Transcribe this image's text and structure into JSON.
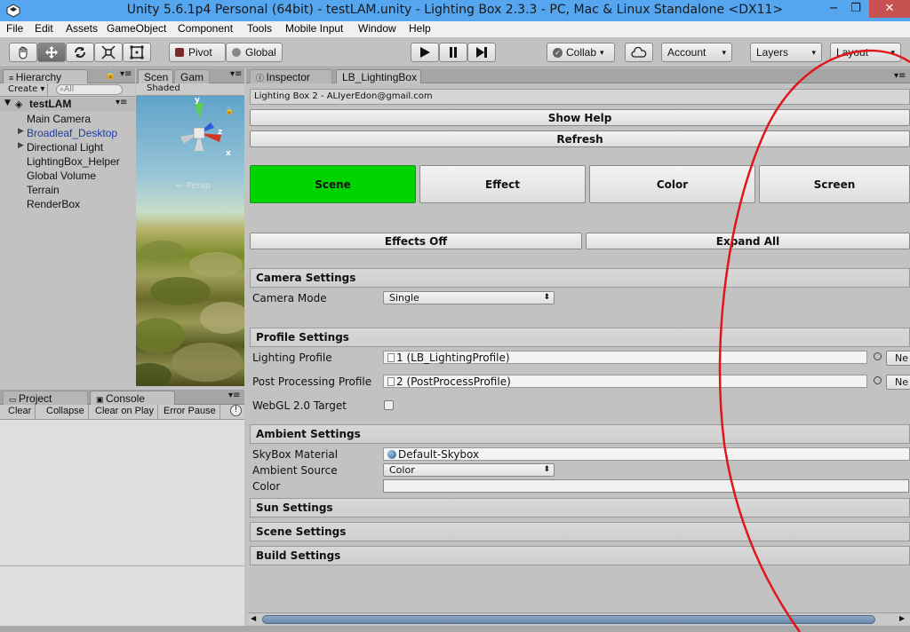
{
  "window": {
    "title": "Unity 5.6.1p4 Personal (64bit) - testLAM.unity - Lighting Box 2.3.3 - PC, Mac & Linux Standalone <DX11>",
    "minimize": "−",
    "maximize": "❐",
    "close": "✕"
  },
  "menu": [
    "File",
    "Edit",
    "Assets",
    "GameObject",
    "Component",
    "Tools",
    "Mobile Input",
    "Window",
    "Help"
  ],
  "toolbar": {
    "pivot": "Pivot",
    "global": "Global",
    "collab": "Collab",
    "account": "Account",
    "layers": "Layers",
    "layout": "Layout",
    "dropdown_glyph": "▾"
  },
  "hierarchy": {
    "tab": "Hierarchy",
    "create": "Create",
    "search_placeholder": "All",
    "scene": "testLAM",
    "items": [
      "Main Camera",
      "Broadleaf_Desktop",
      "Directional Light",
      "LightingBox_Helper",
      "Global Volume",
      "Terrain",
      "RenderBox"
    ]
  },
  "scene_view": {
    "tab_scene": "Scen",
    "tab_game": "Gam",
    "shading": "Shaded",
    "gizmo_persp": "← Persp",
    "axis_y": "y",
    "axis_z": "z",
    "axis_x": "x"
  },
  "console": {
    "tab_project": "Project",
    "tab_console": "Console",
    "buttons": [
      "Clear",
      "Collapse",
      "Clear on Play",
      "Error Pause"
    ]
  },
  "inspector": {
    "tab_inspector": "Inspector",
    "tab_lighting": "LB_LightingBox",
    "header": "Lighting Box 2 - ALIyerEdon@gmail.com",
    "show_help": "Show Help",
    "refresh": "Refresh",
    "categories": [
      "Scene",
      "Effect",
      "Color",
      "Screen"
    ],
    "effects_off": "Effects Off",
    "expand_all": "Expand All",
    "camera_settings": "Camera Settings",
    "camera_mode_label": "Camera Mode",
    "camera_mode_value": "Single",
    "profile_settings": "Profile Settings",
    "lighting_profile_label": "Lighting Profile",
    "lighting_profile_value": "1 (LB_LightingProfile)",
    "post_profile_label": "Post Processing Profile",
    "post_profile_value": "2 (PostProcessProfile)",
    "new_button": "Ne",
    "webgl_label": "WebGL 2.0 Target",
    "ambient_settings": "Ambient Settings",
    "skybox_label": "SkyBox Material",
    "skybox_value": "Default-Skybox",
    "ambient_source_label": "Ambient Source",
    "ambient_source_value": "Color",
    "color_label": "Color",
    "sun_settings": "Sun Settings",
    "scene_settings": "Scene Settings",
    "build_settings": "Build Settings"
  },
  "colors": {
    "title_bar": "#55a5ef",
    "scene_active": "#00d400",
    "annotation": "#e0161b"
  }
}
